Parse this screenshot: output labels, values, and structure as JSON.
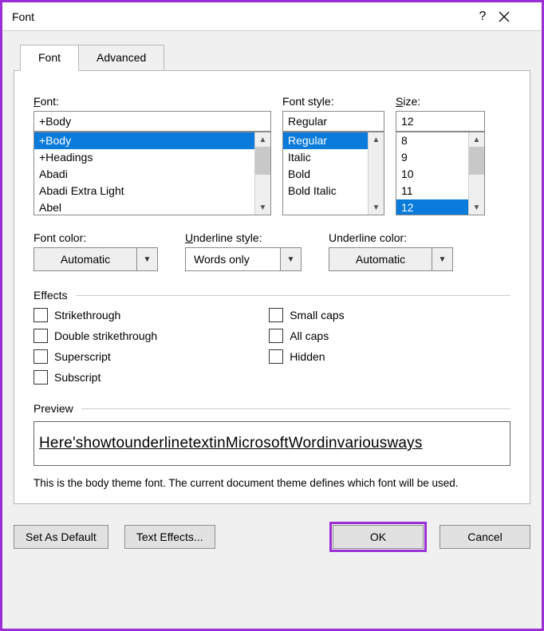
{
  "window": {
    "title": "Font",
    "help_tooltip": "?",
    "close_tooltip": "Close"
  },
  "tabs": {
    "font": "Font",
    "advanced": "Advanced"
  },
  "labels": {
    "font": "Font:",
    "font_style": "Font style:",
    "size": "Size:",
    "font_color": "Font color:",
    "underline_style": "Underline style:",
    "underline_color": "Underline color:",
    "effects": "Effects",
    "preview": "Preview"
  },
  "font": {
    "value": "+Body",
    "list": [
      "+Body",
      "+Headings",
      "Abadi",
      "Abadi Extra Light",
      "Abel"
    ],
    "selected_index": 0
  },
  "font_style": {
    "value": "Regular",
    "list": [
      "Regular",
      "Italic",
      "Bold",
      "Bold Italic"
    ],
    "selected_index": 0
  },
  "size": {
    "value": "12",
    "list": [
      "8",
      "9",
      "10",
      "11",
      "12"
    ],
    "selected_index": 4
  },
  "font_color": {
    "value": "Automatic"
  },
  "underline_style": {
    "value": "Words only"
  },
  "underline_color": {
    "value": "Automatic"
  },
  "effects": {
    "strikethrough": "Strikethrough",
    "double_strike": "Double strikethrough",
    "superscript": "Superscript",
    "subscript": "Subscript",
    "small_caps": "Small caps",
    "all_caps": "All caps",
    "hidden": "Hidden"
  },
  "preview_words": [
    "Here's",
    "how",
    "to",
    "underline",
    "text",
    "in",
    "Microsoft",
    "Word",
    "in",
    "various",
    "ways"
  ],
  "description": "This is the body theme font. The current document theme defines which font will be used.",
  "buttons": {
    "set_default": "Set As Default",
    "text_effects": "Text Effects...",
    "ok": "OK",
    "cancel": "Cancel"
  }
}
